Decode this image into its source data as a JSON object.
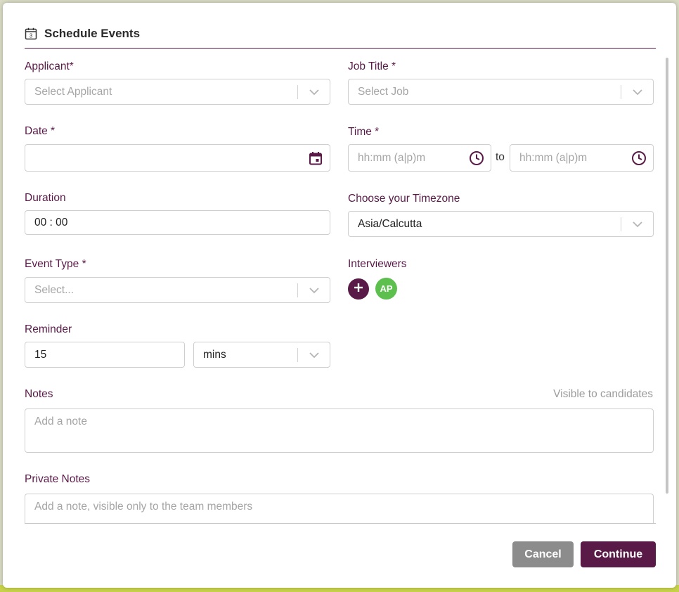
{
  "modal": {
    "title": "Schedule Events",
    "icon": "calendar-icon"
  },
  "colors": {
    "brand": "#5a1a48",
    "avatar": "#5cbf4e",
    "cancel": "#8c8c8c"
  },
  "applicant": {
    "label": "Applicant*",
    "placeholder": "Select Applicant"
  },
  "job_title": {
    "label": "Job Title *",
    "placeholder": "Select Job"
  },
  "date": {
    "label": "Date *",
    "value": "",
    "icon": "calendar-icon"
  },
  "time": {
    "label": "Time *",
    "start_placeholder": "hh:mm (a|p)m",
    "end_placeholder": "hh:mm (a|p)m",
    "separator": "to",
    "icon": "clock-icon"
  },
  "duration": {
    "label": "Duration",
    "value": "00 : 00"
  },
  "timezone": {
    "label": "Choose your Timezone",
    "value": "Asia/Calcutta"
  },
  "event_type": {
    "label": "Event Type *",
    "placeholder": "Select..."
  },
  "interviewers": {
    "label": "Interviewers",
    "add_icon": "plus-icon",
    "avatars": [
      "AP"
    ]
  },
  "reminder": {
    "label": "Reminder",
    "value": "15",
    "unit": "mins"
  },
  "notes": {
    "label": "Notes",
    "hint": "Visible to candidates",
    "placeholder": "Add a note"
  },
  "private_notes": {
    "label": "Private Notes",
    "placeholder": "Add a note, visible only to the team members"
  },
  "buttons": {
    "cancel": "Cancel",
    "continue": "Continue"
  }
}
